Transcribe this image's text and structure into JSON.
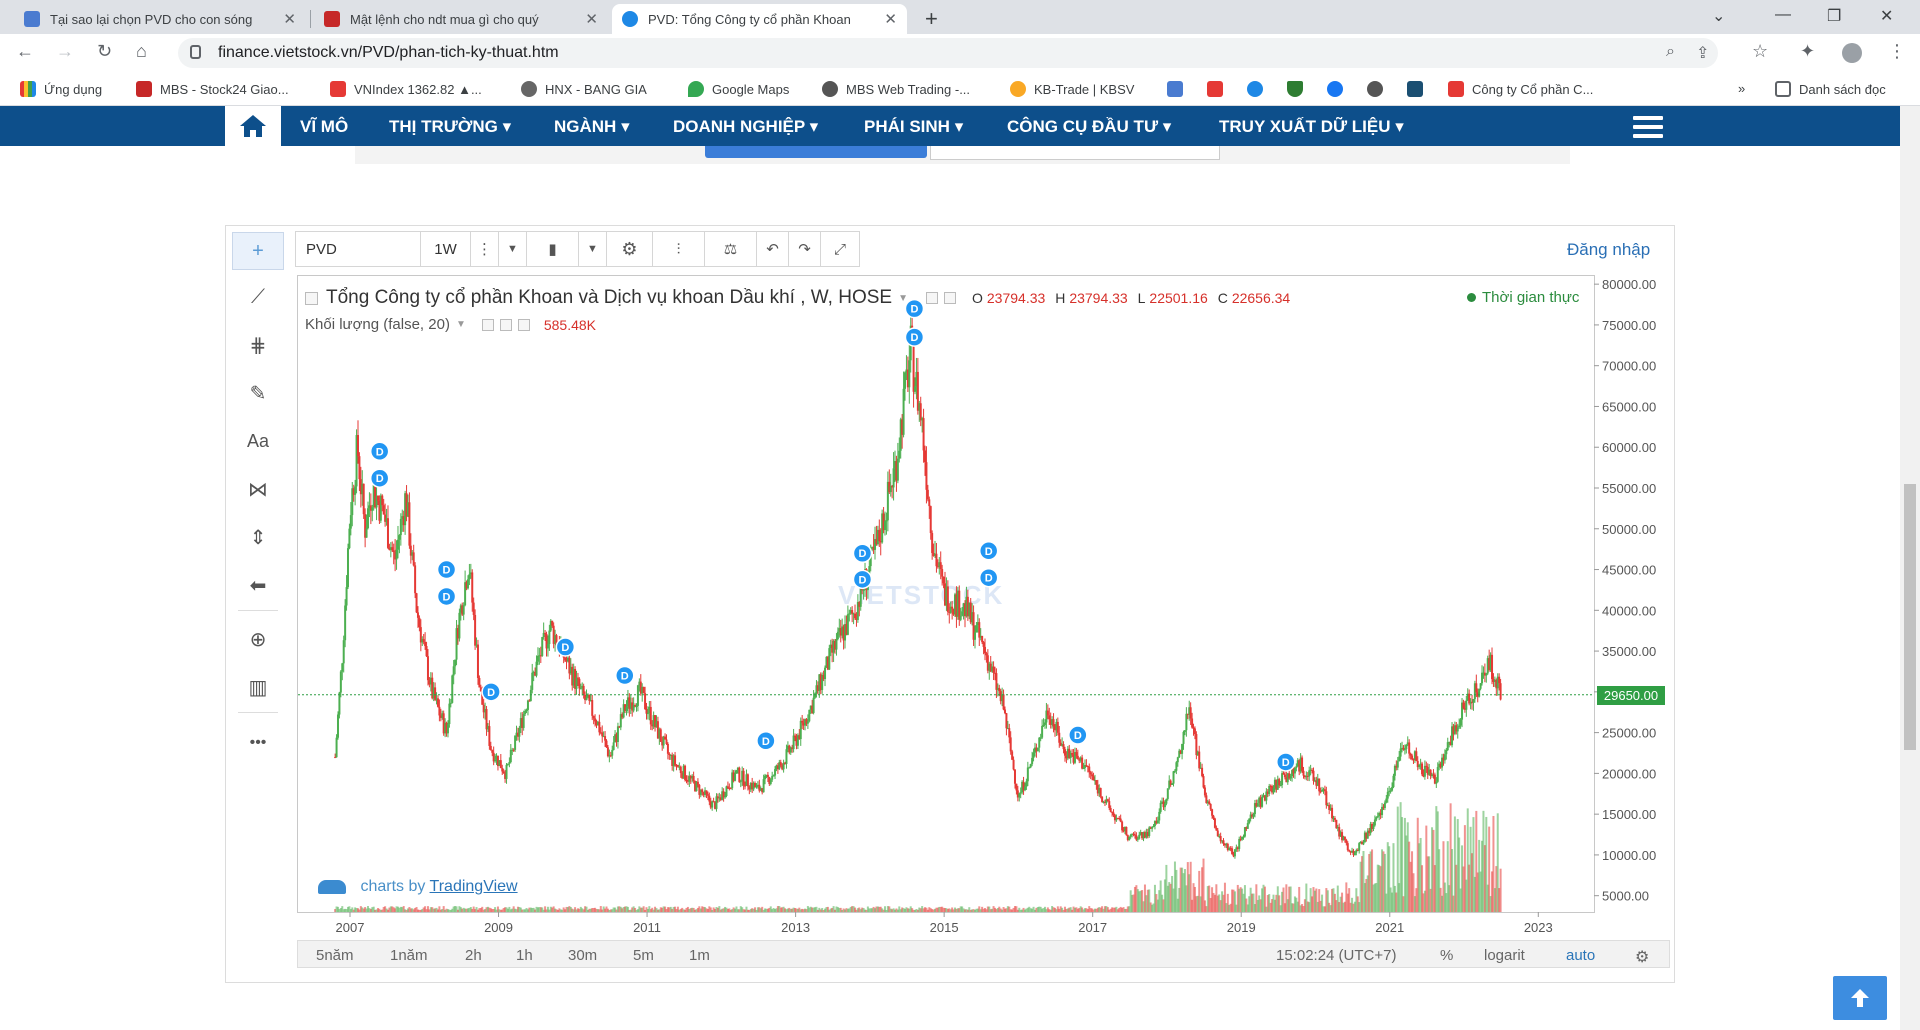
{
  "browser": {
    "tabs": [
      {
        "title": "Tại sao lại chọn PVD cho con sóng",
        "fav": "#4a7bd0"
      },
      {
        "title": "Mật lệnh cho ndt mua gì cho quý",
        "fav": "#c62828"
      },
      {
        "title": "PVD: Tổng Công ty cổ phần Khoan",
        "fav": "#1e88e5"
      }
    ],
    "url": "finance.vietstock.vn/PVD/phan-tich-ky-thuat.htm",
    "bookmarks": [
      {
        "label": "Ứng dụng",
        "color": "#e53935"
      },
      {
        "label": "MBS - Stock24 Giao...",
        "color": "#c62828"
      },
      {
        "label": "VNIndex 1362.82 ▲...",
        "color": "#e53935"
      },
      {
        "label": "HNX - BANG GIA",
        "color": "#666666"
      },
      {
        "label": "Google Maps",
        "color": "#34a853"
      },
      {
        "label": "MBS Web Trading -...",
        "color": "#555555"
      },
      {
        "label": "KB-Trade | KBSV",
        "color": "#f9a825"
      },
      {
        "label": "Công ty Cổ phần C...",
        "color": "#e53935"
      }
    ],
    "reading_list": "Danh sách đọc"
  },
  "site_nav": {
    "items": [
      "VĨ MÔ",
      "THỊ TRƯỜNG",
      "NGÀNH",
      "DOANH NGHIỆP",
      "PHÁI SINH",
      "CÔNG CỤ ĐẦU TƯ",
      "TRUY XUẤT DỮ LIỆU"
    ]
  },
  "chart_toolbar": {
    "symbol": "PVD",
    "interval": "1W",
    "login": "Đăng nhập"
  },
  "legend": {
    "title": "Tổng Công ty cổ phần Khoan và Dịch vụ khoan Dầu khí , W, HOSE",
    "o_label": "O",
    "o": "23794.33",
    "h_label": "H",
    "h": "23794.33",
    "l_label": "L",
    "l": "22501.16",
    "c_label": "C",
    "c": "22656.34",
    "volume_label": "Khối lượng (false, 20)",
    "volume_value": "585.48K",
    "realtime": "Thời gian thực"
  },
  "branding": {
    "prefix": "charts by",
    "brand": "TradingView",
    "watermark": "VIETSTOCK"
  },
  "price_tag": "29650.00",
  "bottom_bar": {
    "ranges": [
      "5năm",
      "1năm",
      "2h",
      "1h",
      "30m",
      "5m",
      "1m"
    ],
    "clock": "15:02:24 (UTC+7)",
    "percent": "%",
    "log": "logarit",
    "auto": "auto"
  },
  "colors": {
    "nav": "#0d4f8b",
    "up": "#4caf50",
    "down": "#e53935",
    "dividend": "#2196f3"
  },
  "chart_data": {
    "type": "candlestick",
    "y_ticks": [
      "80000.00",
      "75000.00",
      "70000.00",
      "65000.00",
      "60000.00",
      "55000.00",
      "50000.00",
      "45000.00",
      "40000.00",
      "35000.00",
      "30000.00",
      "25000.00",
      "20000.00",
      "15000.00",
      "10000.00",
      "5000.00"
    ],
    "ylim": [
      3000,
      81000
    ],
    "x_ticks": [
      "2007",
      "2009",
      "2011",
      "2013",
      "2015",
      "2017",
      "2019",
      "2021",
      "2023"
    ],
    "x_ticks_year": [
      2007,
      2009,
      2011,
      2013,
      2015,
      2017,
      2019,
      2021,
      2023
    ],
    "xlim": [
      2006.3,
      2023.75
    ],
    "last_price": 29650,
    "dividend_label": "D",
    "dividend_markers": [
      {
        "t": 2007.4,
        "p": 59500
      },
      {
        "t": 2007.4,
        "p": 56200
      },
      {
        "t": 2008.3,
        "p": 45000
      },
      {
        "t": 2008.3,
        "p": 41700
      },
      {
        "t": 2008.9,
        "p": 30000
      },
      {
        "t": 2009.9,
        "p": 35500
      },
      {
        "t": 2010.7,
        "p": 32000
      },
      {
        "t": 2012.6,
        "p": 24000
      },
      {
        "t": 2013.9,
        "p": 47000
      },
      {
        "t": 2013.9,
        "p": 43800
      },
      {
        "t": 2014.6,
        "p": 77000
      },
      {
        "t": 2014.6,
        "p": 73500
      },
      {
        "t": 2015.6,
        "p": 47300
      },
      {
        "t": 2015.6,
        "p": 44000
      },
      {
        "t": 2016.8,
        "p": 24700
      },
      {
        "t": 2019.6,
        "p": 21400
      }
    ],
    "price_path": [
      [
        2006.8,
        22000
      ],
      [
        2006.9,
        35000
      ],
      [
        2007.0,
        52000
      ],
      [
        2007.1,
        60000
      ],
      [
        2007.2,
        50000
      ],
      [
        2007.3,
        55000
      ],
      [
        2007.45,
        52000
      ],
      [
        2007.6,
        46000
      ],
      [
        2007.75,
        54000
      ],
      [
        2007.9,
        40000
      ],
      [
        2008.1,
        30000
      ],
      [
        2008.3,
        25000
      ],
      [
        2008.45,
        38000
      ],
      [
        2008.6,
        46000
      ],
      [
        2008.75,
        30000
      ],
      [
        2008.9,
        23000
      ],
      [
        2009.1,
        20000
      ],
      [
        2009.3,
        26000
      ],
      [
        2009.5,
        33000
      ],
      [
        2009.7,
        38000
      ],
      [
        2009.9,
        34000
      ],
      [
        2010.1,
        30000
      ],
      [
        2010.3,
        27000
      ],
      [
        2010.5,
        22000
      ],
      [
        2010.7,
        28000
      ],
      [
        2010.9,
        30000
      ],
      [
        2011.1,
        26000
      ],
      [
        2011.3,
        22000
      ],
      [
        2011.6,
        19000
      ],
      [
        2011.9,
        16000
      ],
      [
        2012.2,
        20000
      ],
      [
        2012.5,
        18000
      ],
      [
        2012.8,
        21000
      ],
      [
        2013.0,
        24000
      ],
      [
        2013.2,
        28000
      ],
      [
        2013.5,
        35000
      ],
      [
        2013.8,
        40000
      ],
      [
        2014.1,
        48000
      ],
      [
        2014.35,
        58000
      ],
      [
        2014.55,
        72000
      ],
      [
        2014.7,
        63000
      ],
      [
        2014.85,
        48000
      ],
      [
        2015.0,
        42000
      ],
      [
        2015.3,
        40000
      ],
      [
        2015.55,
        35000
      ],
      [
        2015.8,
        28000
      ],
      [
        2016.0,
        17000
      ],
      [
        2016.2,
        22000
      ],
      [
        2016.4,
        28000
      ],
      [
        2016.6,
        23000
      ],
      [
        2016.9,
        21000
      ],
      [
        2017.2,
        16000
      ],
      [
        2017.5,
        12000
      ],
      [
        2017.8,
        13000
      ],
      [
        2018.1,
        20000
      ],
      [
        2018.3,
        28000
      ],
      [
        2018.5,
        18000
      ],
      [
        2018.7,
        12000
      ],
      [
        2018.9,
        10000
      ],
      [
        2019.2,
        16000
      ],
      [
        2019.5,
        19000
      ],
      [
        2019.8,
        21000
      ],
      [
        2020.1,
        18000
      ],
      [
        2020.3,
        13000
      ],
      [
        2020.5,
        10000
      ],
      [
        2020.8,
        14000
      ],
      [
        2021.0,
        18000
      ],
      [
        2021.2,
        24000
      ],
      [
        2021.4,
        21000
      ],
      [
        2021.6,
        19000
      ],
      [
        2021.8,
        24000
      ],
      [
        2022.0,
        28000
      ],
      [
        2022.2,
        31000
      ],
      [
        2022.35,
        33500
      ],
      [
        2022.5,
        29650
      ]
    ]
  }
}
